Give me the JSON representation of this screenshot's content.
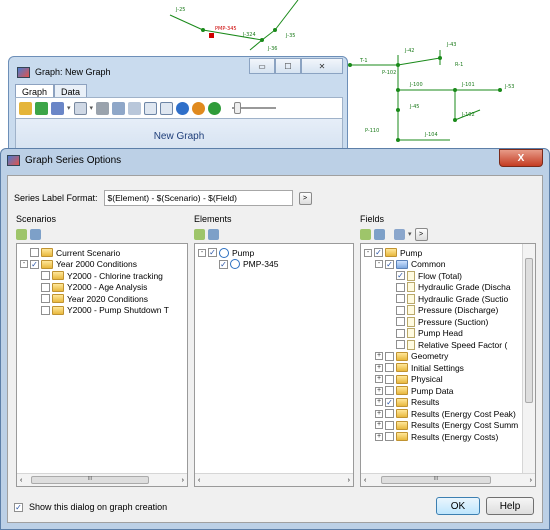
{
  "network": {
    "labels": [
      "J-25",
      "PMP-345",
      "J-324",
      "J-36",
      "J-35",
      "T-1",
      "P-102",
      "J-42",
      "J-43",
      "R-1",
      "J-100",
      "J-101",
      "J-53",
      "J-45",
      "J-102",
      "J-104",
      "P-110"
    ]
  },
  "graph_window": {
    "title": "Graph: New Graph",
    "tabs": [
      {
        "label": "Graph"
      },
      {
        "label": "Data"
      }
    ],
    "graph_title": "New Graph",
    "controls": {
      "minimize": "▭",
      "maximize": "☐",
      "close": "✕"
    }
  },
  "dialog": {
    "title": "Graph Series Options",
    "close": "X",
    "series_label_format": {
      "label": "Series Label Format:",
      "value": "$(Element) - $(Scenario) - $(Field)",
      "button": ">"
    },
    "scenarios": {
      "header": "Scenarios",
      "items": [
        {
          "label": "Current Scenario",
          "level": 0,
          "expander": "",
          "checked": false
        },
        {
          "label": "Year 2000 Conditions",
          "level": 0,
          "expander": "-",
          "checked": true
        },
        {
          "label": "Y2000 - Chlorine tracking",
          "level": 1,
          "expander": "",
          "checked": false
        },
        {
          "label": "Y2000 - Age Analysis",
          "level": 1,
          "expander": "",
          "checked": false
        },
        {
          "label": "Year 2020 Conditions",
          "level": 1,
          "expander": "",
          "checked": false
        },
        {
          "label": "Y2000 - Pump Shutdown T",
          "level": 1,
          "expander": "",
          "checked": false
        }
      ]
    },
    "elements": {
      "header": "Elements",
      "items": [
        {
          "label": "Pump",
          "level": 0,
          "expander": "-",
          "checked": true
        },
        {
          "label": "PMP-345",
          "level": 1,
          "expander": "",
          "checked": true
        }
      ]
    },
    "fields": {
      "header": "Fields",
      "items": [
        {
          "label": "Pump",
          "level": 0,
          "expander": "-",
          "checked": true,
          "kind": "folder"
        },
        {
          "label": "Common",
          "level": 1,
          "expander": "-",
          "checked": true,
          "kind": "folder-blue"
        },
        {
          "label": "Flow (Total)",
          "level": 2,
          "expander": "",
          "checked": true,
          "kind": "doc"
        },
        {
          "label": "Hydraulic Grade (Discha",
          "level": 2,
          "expander": "",
          "checked": false,
          "kind": "doc"
        },
        {
          "label": "Hydraulic Grade (Suctio",
          "level": 2,
          "expander": "",
          "checked": false,
          "kind": "doc"
        },
        {
          "label": "Pressure (Discharge)",
          "level": 2,
          "expander": "",
          "checked": false,
          "kind": "doc"
        },
        {
          "label": "Pressure (Suction)",
          "level": 2,
          "expander": "",
          "checked": false,
          "kind": "doc"
        },
        {
          "label": "Pump Head",
          "level": 2,
          "expander": "",
          "checked": false,
          "kind": "doc"
        },
        {
          "label": "Relative Speed Factor (",
          "level": 2,
          "expander": "",
          "checked": false,
          "kind": "doc"
        },
        {
          "label": "Geometry",
          "level": 1,
          "expander": "+",
          "checked": false,
          "kind": "folder"
        },
        {
          "label": "Initial Settings",
          "level": 1,
          "expander": "+",
          "checked": false,
          "kind": "folder"
        },
        {
          "label": "Physical",
          "level": 1,
          "expander": "+",
          "checked": false,
          "kind": "folder"
        },
        {
          "label": "Pump Data",
          "level": 1,
          "expander": "+",
          "checked": false,
          "kind": "folder"
        },
        {
          "label": "Results",
          "level": 1,
          "expander": "+",
          "checked": true,
          "kind": "folder"
        },
        {
          "label": "Results (Energy Cost Peak)",
          "level": 1,
          "expander": "+",
          "checked": false,
          "kind": "folder"
        },
        {
          "label": "Results (Energy Cost Summ",
          "level": 1,
          "expander": "+",
          "checked": false,
          "kind": "folder"
        },
        {
          "label": "Results (Energy Costs)",
          "level": 1,
          "expander": "+",
          "checked": false,
          "kind": "folder"
        }
      ]
    },
    "show_on_creation": {
      "label": "Show this dialog on graph creation",
      "checked": true
    },
    "buttons": {
      "ok": "OK",
      "help": "Help"
    },
    "scroll": {
      "left": "‹",
      "right": "›",
      "grip": "III"
    }
  }
}
